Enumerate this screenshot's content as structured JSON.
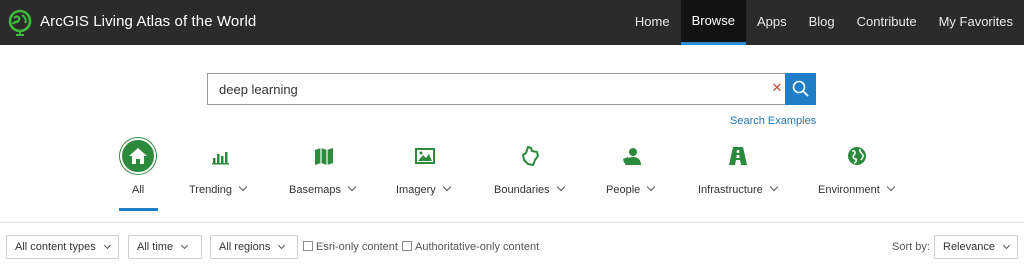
{
  "header": {
    "brand": "ArcGIS Living Atlas of the World",
    "nav": [
      "Home",
      "Browse",
      "Apps",
      "Blog",
      "Contribute",
      "My Favorites"
    ],
    "active_nav": "Browse"
  },
  "search": {
    "value": "deep learning",
    "examples_link": "Search Examples"
  },
  "categories": [
    {
      "label": "All",
      "icon": "home-icon"
    },
    {
      "label": "Trending",
      "icon": "bar-chart-icon"
    },
    {
      "label": "Basemaps",
      "icon": "map-icon"
    },
    {
      "label": "Imagery",
      "icon": "image-icon"
    },
    {
      "label": "Boundaries",
      "icon": "boundary-icon"
    },
    {
      "label": "People",
      "icon": "people-icon"
    },
    {
      "label": "Infrastructure",
      "icon": "road-icon"
    },
    {
      "label": "Environment",
      "icon": "globe-icon"
    }
  ],
  "filters": {
    "content_types": "All content types",
    "time": "All time",
    "regions": "All regions",
    "esri_only": "Esri-only content",
    "authoritative_only": "Authoritative-only content",
    "sort_label": "Sort by:",
    "sort_value": "Relevance"
  },
  "colors": {
    "header_bg": "#2b2b2b",
    "accent_blue": "#1e7ec8",
    "category_green": "#2c8a3c",
    "logo_green": "#3dbb3a"
  }
}
